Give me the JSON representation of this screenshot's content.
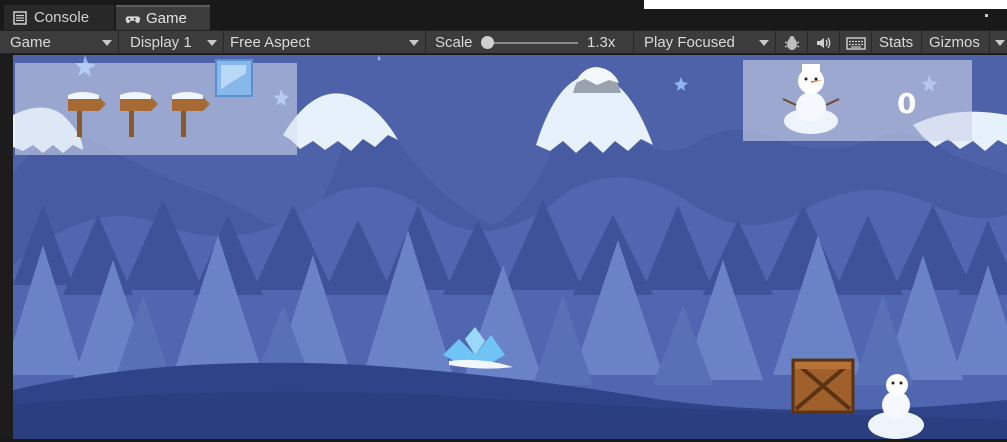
{
  "tabs": [
    {
      "label": "Console",
      "icon": "console-icon",
      "active": false
    },
    {
      "label": "Game",
      "icon": "gamepad-icon",
      "active": true
    }
  ],
  "toolbar": {
    "view_dropdown": "Game",
    "display_dropdown": "Display 1",
    "aspect_dropdown": "Free Aspect",
    "scale_label": "Scale",
    "scale_value": "1.3x",
    "play_mode_dropdown": "Play Focused",
    "stats_label": "Stats",
    "gizmos_label": "Gizmos",
    "icons": [
      "bug-icon",
      "speaker-icon",
      "keyboard-icon"
    ]
  },
  "game": {
    "score": "0",
    "signposts_count": 3,
    "colors": {
      "sky": "#4d62a8",
      "far_mountains": "#4a5ea6",
      "mid_hills": "#5166b0",
      "trees_dark": "#3a4f97",
      "trees_light": "#6d84c8",
      "ground": "#2f4488",
      "snow": "#e9f2fb"
    }
  }
}
